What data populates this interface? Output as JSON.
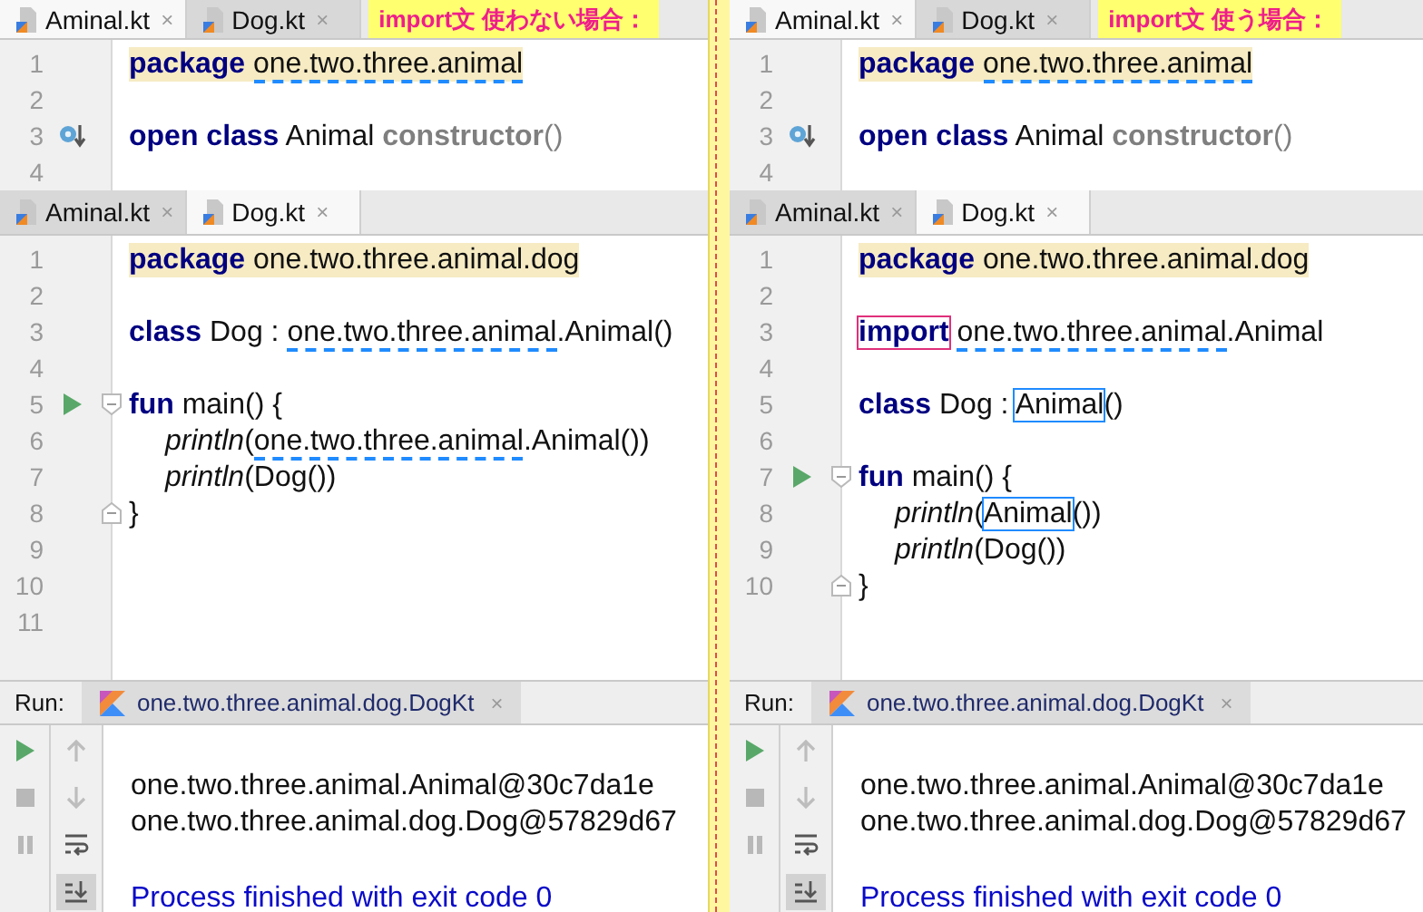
{
  "panes": [
    {
      "annotation": "import文 使わない場合：",
      "editors": [
        {
          "tabs": [
            {
              "label": "Aminal.kt",
              "close": "×",
              "selected": true
            },
            {
              "label": "Dog.kt",
              "close": "×",
              "selected": false
            }
          ],
          "lines": [
            {
              "no": "1",
              "highlighted": true,
              "tokens": [
                {
                  "text": "package ",
                  "kind": "keyword"
                },
                {
                  "text": "one.two.three.animal",
                  "kind": "ref"
                }
              ]
            },
            {
              "no": "2",
              "highlighted": false
            },
            {
              "no": "3",
              "highlighted": false,
              "marker": {
                "kind": "override"
              },
              "tokens": [
                {
                  "text": "open class",
                  "kind": "keyword"
                },
                {
                  "text": " Animal ",
                  "kind": "text"
                },
                {
                  "text": "constructor",
                  "kind": "muted"
                },
                {
                  "text": "()",
                  "kind": "paren"
                }
              ]
            },
            {
              "no": "4",
              "highlighted": false
            }
          ]
        },
        {
          "tabs": [
            {
              "label": "Aminal.kt",
              "close": "×",
              "selected": false
            },
            {
              "label": "Dog.kt",
              "close": "×",
              "selected": true
            }
          ],
          "lines": [
            {
              "no": "1",
              "highlighted": true,
              "tokens": [
                {
                  "text": "package",
                  "kind": "keyword"
                },
                {
                  "text": " one.two.three.animal.dog",
                  "kind": "text"
                }
              ]
            },
            {
              "no": "2",
              "highlighted": false
            },
            {
              "no": "3",
              "highlighted": false,
              "tokens": [
                {
                  "text": "class",
                  "kind": "keyword"
                },
                {
                  "text": " Dog : ",
                  "kind": "text"
                },
                {
                  "text": "one.two.three.animal",
                  "kind": "ref"
                },
                {
                  "text": ".Animal()",
                  "kind": "text"
                }
              ]
            },
            {
              "no": "4",
              "highlighted": false
            },
            {
              "no": "5",
              "highlighted": false,
              "marker": {
                "kind": "run"
              },
              "fold": {
                "kind": "open"
              },
              "tokens": [
                {
                  "text": "fun",
                  "kind": "keyword"
                },
                {
                  "text": " main() {",
                  "kind": "text"
                }
              ],
              "children": [
                {
                  "no": "6",
                  "highlighted": false,
                  "tokens": [
                    {
                      "text": "println",
                      "kind": "call"
                    },
                    {
                      "text": "(",
                      "kind": "text"
                    },
                    {
                      "text": "one.two.three.animal",
                      "kind": "ref"
                    },
                    {
                      "text": ".Animal())",
                      "kind": "text"
                    }
                  ]
                },
                {
                  "no": "7",
                  "highlighted": false,
                  "tokens": [
                    {
                      "text": "println",
                      "kind": "call"
                    },
                    {
                      "text": "(Dog())",
                      "kind": "text"
                    }
                  ]
                }
              ]
            },
            {
              "no": "8",
              "highlighted": false,
              "fold": {
                "kind": "close"
              },
              "tokens": [
                {
                  "text": "}",
                  "kind": "text"
                }
              ]
            },
            {
              "no": "9",
              "highlighted": false
            },
            {
              "no": "10",
              "highlighted": false
            },
            {
              "no": "11",
              "highlighted": false
            }
          ]
        }
      ],
      "run": {
        "label": "Run:",
        "tab": "one.two.three.animal.dog.DogKt",
        "close": "×",
        "output": [
          {
            "text": "one.two.three.animal.Animal@30c7da1e",
            "kind": "stdout"
          },
          {
            "text": "one.two.three.animal.dog.Dog@57829d67",
            "kind": "stdout"
          },
          {
            "kind": "blank"
          },
          {
            "text": "Process finished with exit code 0",
            "kind": "system"
          }
        ]
      }
    },
    {
      "annotation": "import文 使う場合：",
      "editors": [
        {
          "tabs": [
            {
              "label": "Aminal.kt",
              "close": "×",
              "selected": true
            },
            {
              "label": "Dog.kt",
              "close": "×",
              "selected": false
            }
          ],
          "lines": [
            {
              "no": "1",
              "highlighted": true,
              "tokens": [
                {
                  "text": "package ",
                  "kind": "keyword"
                },
                {
                  "text": "one.two.three.animal",
                  "kind": "ref"
                }
              ]
            },
            {
              "no": "2",
              "highlighted": false
            },
            {
              "no": "3",
              "highlighted": false,
              "marker": {
                "kind": "override"
              },
              "tokens": [
                {
                  "text": "open class",
                  "kind": "keyword"
                },
                {
                  "text": " Animal ",
                  "kind": "text"
                },
                {
                  "text": "constructor",
                  "kind": "muted"
                },
                {
                  "text": "()",
                  "kind": "paren"
                }
              ]
            },
            {
              "no": "4",
              "highlighted": false
            }
          ]
        },
        {
          "tabs": [
            {
              "label": "Aminal.kt",
              "close": "×",
              "selected": false
            },
            {
              "label": "Dog.kt",
              "close": "×",
              "selected": true
            }
          ],
          "lines": [
            {
              "no": "1",
              "highlighted": true,
              "tokens": [
                {
                  "text": "package",
                  "kind": "keyword"
                },
                {
                  "text": " one.two.three.animal.dog",
                  "kind": "text"
                }
              ]
            },
            {
              "no": "2",
              "highlighted": false
            },
            {
              "no": "3",
              "highlighted": false,
              "tokens": [
                {
                  "text": "import ",
                  "kind": "marked-keyword"
                },
                {
                  "text": "one.two.three.animal",
                  "kind": "ref"
                },
                {
                  "text": ".Animal",
                  "kind": "text"
                }
              ]
            },
            {
              "no": "4",
              "highlighted": false
            },
            {
              "no": "5",
              "highlighted": false,
              "tokens": [
                {
                  "text": "class",
                  "kind": "keyword"
                },
                {
                  "text": " Dog : ",
                  "kind": "text"
                },
                {
                  "text": "Animal",
                  "kind": "marked"
                },
                {
                  "text": "()",
                  "kind": "text"
                }
              ]
            },
            {
              "no": "6",
              "highlighted": false
            },
            {
              "no": "7",
              "highlighted": false,
              "marker": {
                "kind": "run"
              },
              "fold": {
                "kind": "open"
              },
              "tokens": [
                {
                  "text": "fun",
                  "kind": "keyword"
                },
                {
                  "text": " main() {",
                  "kind": "text"
                }
              ],
              "children": [
                {
                  "no": "8",
                  "highlighted": false,
                  "tokens": [
                    {
                      "text": "println",
                      "kind": "call"
                    },
                    {
                      "text": "(",
                      "kind": "text"
                    },
                    {
                      "text": "Animal",
                      "kind": "marked"
                    },
                    {
                      "text": "())",
                      "kind": "text"
                    }
                  ]
                },
                {
                  "no": "9",
                  "highlighted": false,
                  "tokens": [
                    {
                      "text": "println",
                      "kind": "call"
                    },
                    {
                      "text": "(Dog())",
                      "kind": "text"
                    }
                  ]
                }
              ]
            },
            {
              "no": "10",
              "highlighted": false,
              "fold": {
                "kind": "close"
              },
              "tokens": [
                {
                  "text": "}",
                  "kind": "text"
                }
              ]
            }
          ]
        }
      ],
      "run": {
        "label": "Run:",
        "tab": "one.two.three.animal.dog.DogKt",
        "close": "×",
        "output": [
          {
            "text": "one.two.three.animal.Animal@30c7da1e",
            "kind": "stdout"
          },
          {
            "text": "one.two.three.animal.dog.Dog@57829d67",
            "kind": "stdout"
          },
          {
            "kind": "blank"
          },
          {
            "text": "Process finished with exit code 0",
            "kind": "system"
          }
        ]
      }
    }
  ]
}
